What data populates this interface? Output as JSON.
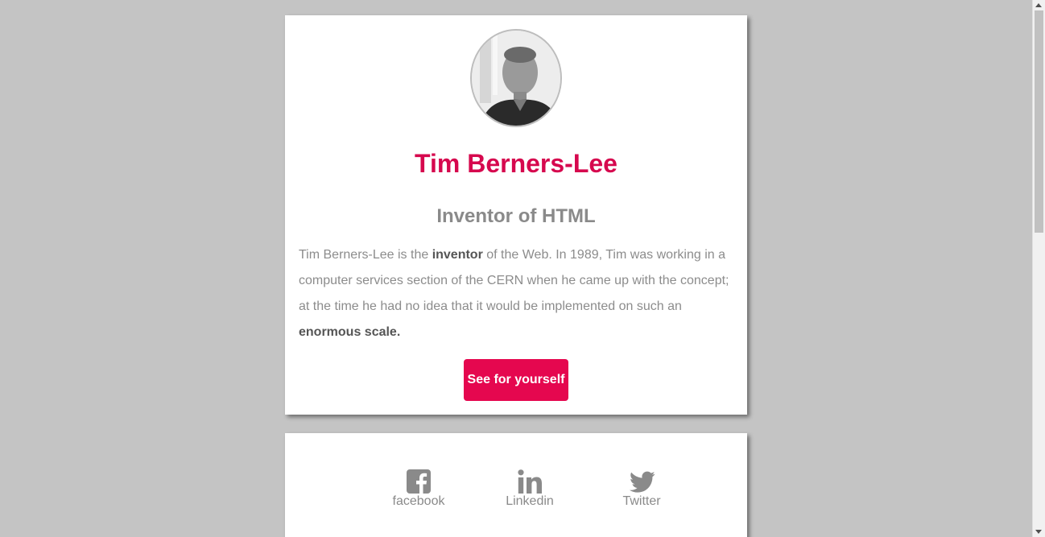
{
  "profile": {
    "name": "Tim Berners-Lee",
    "subtitle": "Inventor of HTML",
    "bio": {
      "part1": "Tim Berners-Lee is the ",
      "bold1": "inventor",
      "part2": " of the Web. In 1989, Tim was working in a computer services section of the CERN when he came up with the concept; at the time he had no idea that it would be implemented on such an ",
      "bold2": "enormous scale."
    },
    "cta_label": "See for yourself"
  },
  "social": {
    "links": [
      {
        "label": "facebook",
        "icon": "facebook-icon"
      },
      {
        "label": "Linkedin",
        "icon": "linkedin-icon"
      },
      {
        "label": "Twitter",
        "icon": "twitter-icon"
      }
    ]
  },
  "colors": {
    "accent": "#d6084e",
    "button": "#e5074f",
    "text_muted": "#8a8a8a",
    "background": "#c4c4c4"
  }
}
